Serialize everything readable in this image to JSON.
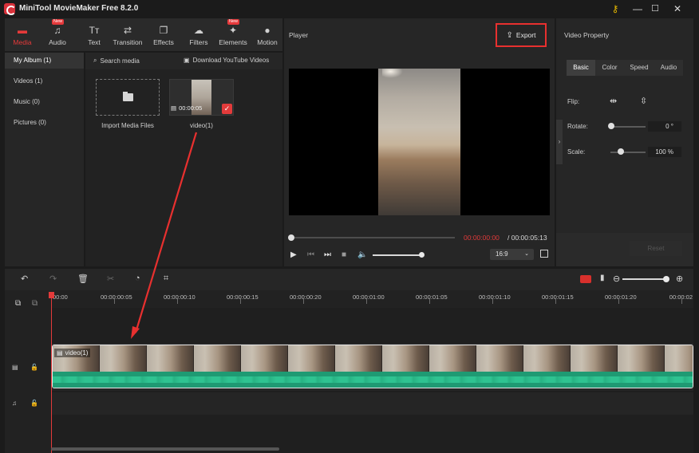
{
  "app": {
    "title": "MiniTool MovieMaker Free 8.2.0"
  },
  "window": {
    "key_icon": "key-icon",
    "minimize": "—",
    "maximize": "☐",
    "close": "✕"
  },
  "toolbar": {
    "items": [
      {
        "label": "Media",
        "icon": "media-icon",
        "active": true,
        "new": false
      },
      {
        "label": "Audio",
        "icon": "music-note-icon",
        "active": false,
        "new": true
      },
      {
        "label": "Text",
        "icon": "text-icon",
        "active": false,
        "new": false
      },
      {
        "label": "Transition",
        "icon": "transition-icon",
        "active": false,
        "new": false
      },
      {
        "label": "Effects",
        "icon": "effects-icon",
        "active": false,
        "new": false
      },
      {
        "label": "Filters",
        "icon": "filters-icon",
        "active": false,
        "new": false
      },
      {
        "label": "Elements",
        "icon": "elements-icon",
        "active": false,
        "new": true
      },
      {
        "label": "Motion",
        "icon": "motion-icon",
        "active": false,
        "new": false
      }
    ],
    "new_badge": "New"
  },
  "media_sidebar": {
    "items": [
      {
        "label": "My Album (1)",
        "active": true
      },
      {
        "label": "Videos (1)",
        "active": false
      },
      {
        "label": "Music (0)",
        "active": false
      },
      {
        "label": "Pictures (0)",
        "active": false
      }
    ]
  },
  "media": {
    "search_label": "Search media",
    "download_label": "Download YouTube Videos",
    "import_label": "Import Media Files",
    "clip": {
      "name": "video(1)",
      "duration": "00:00:05",
      "selected": true
    }
  },
  "player": {
    "title": "Player",
    "export_label": "Export",
    "time_current": "00:00:00:00",
    "time_total": " / 00:00:05:13",
    "aspect_ratio": "16:9"
  },
  "video_property": {
    "title": "Video Property",
    "tabs": [
      "Basic",
      "Color",
      "Speed",
      "Audio"
    ],
    "active_tab": "Basic",
    "flip_label": "Flip:",
    "rotate_label": "Rotate:",
    "rotate_value": "0 °",
    "scale_label": "Scale:",
    "scale_value": "100 %",
    "reset_label": "Reset"
  },
  "timeline": {
    "ruler_labels": [
      "00:00",
      "00:00:00:05",
      "00:00:00:10",
      "00:00:00:15",
      "00:00:00:20",
      "00:00:01:00",
      "00:00:01:05",
      "00:00:01:10",
      "00:00:01:15",
      "00:00:01:20",
      "00:00:02"
    ],
    "clip_name": "video(1)"
  },
  "colors": {
    "accent": "#e53a3a",
    "waveform": "#2fc391",
    "background": "#1b1b1b"
  }
}
